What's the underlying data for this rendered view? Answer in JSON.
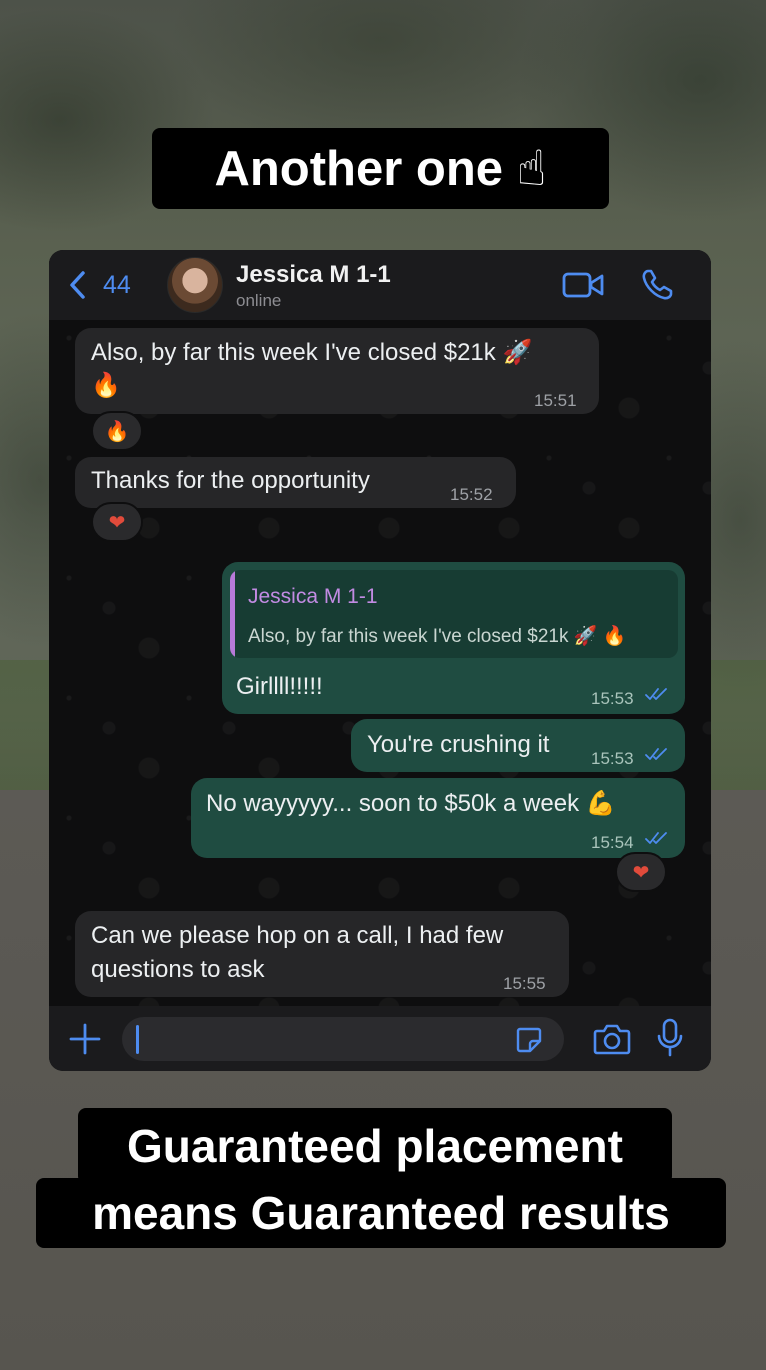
{
  "captions": {
    "top": "Another one",
    "top_emoji": "☝",
    "bottom_line1": "Guaranteed placement",
    "bottom_line2": "means Guaranteed results"
  },
  "chat": {
    "header": {
      "back_count": "44",
      "contact_name": "Jessica M 1-1",
      "status": "online"
    },
    "messages": [
      {
        "direction": "incoming",
        "text": "Also, by far this week I've closed $21k 🚀",
        "text_line2": "🔥",
        "time": "15:51",
        "reaction": "🔥"
      },
      {
        "direction": "incoming",
        "text": "Thanks for the opportunity",
        "time": "15:52",
        "reaction": "❤"
      },
      {
        "direction": "outgoing",
        "quote_name": "Jessica M 1-1",
        "quote_text": "Also, by far this week I've closed $21k 🚀 🔥",
        "text": "Girllll!!!!!",
        "time": "15:53",
        "read": true
      },
      {
        "direction": "outgoing",
        "text": "You're crushing it",
        "time": "15:53",
        "read": true
      },
      {
        "direction": "outgoing",
        "text": "No wayyyyy... soon to $50k a week 💪",
        "time": "15:54",
        "read": true,
        "reaction": "❤"
      },
      {
        "direction": "incoming",
        "text": "Can we please hop on a call, I had few",
        "text_line2": "questions to ask",
        "time": "15:55"
      }
    ],
    "input": {
      "value": ""
    },
    "colors": {
      "accent": "#4e8cf0",
      "incoming_bubble": "#262628",
      "outgoing_bubble": "#1f4c41",
      "quote_name": "#c28be3"
    }
  }
}
